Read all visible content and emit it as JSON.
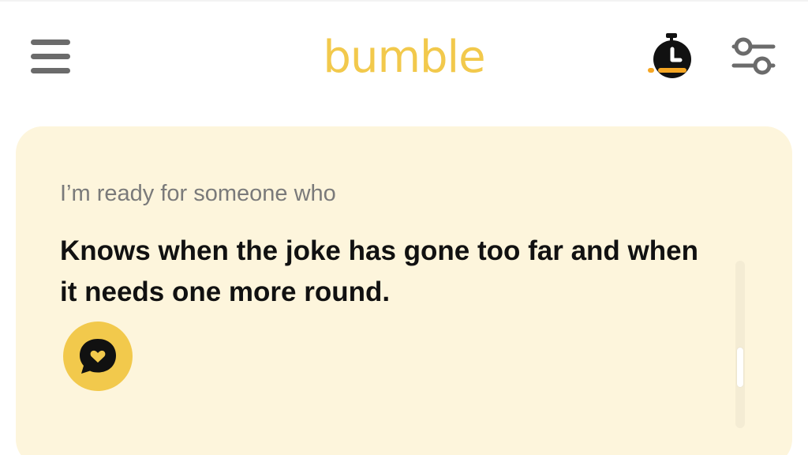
{
  "app": {
    "logo_text": "bumble",
    "brand_color": "#f2c94c",
    "card_background": "#fdf5dc",
    "accent_orange": "#f5a623"
  },
  "header": {
    "menu_icon": "hamburger-menu-icon",
    "timer_icon": "stopwatch-icon",
    "filter_icon": "filter-sliders-icon"
  },
  "card": {
    "prompt_label": "I’m ready for someone who",
    "prompt_answer": "Knows when the joke has gone too far and when it needs one more round.",
    "comment_icon": "heart-speech-bubble-icon"
  }
}
